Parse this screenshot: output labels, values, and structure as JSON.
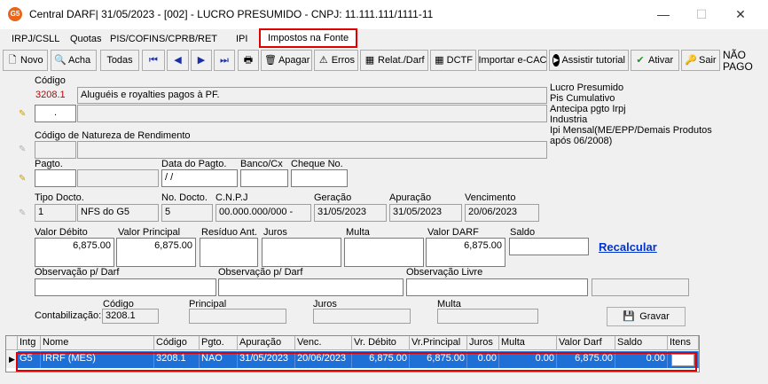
{
  "window": {
    "app_icon": "G5",
    "title": "Central DARF|  31/05/2023 - [002] - LUCRO PRESUMIDO - CNPJ: 11.111.111/1111-11",
    "minimize": "—",
    "maximize": "☐",
    "close": "✕"
  },
  "tabs": [
    "IRPJ/CSLL",
    "Quotas",
    "PIS/COFINS/CPRB/RET",
    "IPI",
    "Impostos na Fonte"
  ],
  "toolbar": {
    "novo": "Novo",
    "acha": "Acha",
    "todas": "Todas",
    "apagar": "Apagar",
    "erros": "Erros",
    "relat": "Relat./Darf",
    "dctf": "DCTF",
    "importar": "Importar e-CAC",
    "assistir": "Assistir tutorial",
    "ativar": "Ativar",
    "sair": "Sair",
    "status_line1": "NÃO",
    "status_line2": "PAGO"
  },
  "form": {
    "codigo_label": "Código",
    "codigo_value": "3208.1",
    "descricao": "Aluguéis e royalties pagos à PF.",
    "small_value": ".",
    "natureza_label": "Código de Natureza de Rendimento",
    "pagto_label": "Pagto.",
    "data_pagto_label": "Data do Pagto.",
    "data_pagto_value": " / /",
    "banco_label": "Banco/Cx",
    "cheque_label": "Cheque No.",
    "tipo_docto_label": "Tipo Docto.",
    "tipo_docto_num": "1",
    "tipo_docto_desc": "NFS do G5",
    "no_docto_label": "No. Docto.",
    "no_docto_value": "5",
    "cnpj_label": "C.N.P.J",
    "cnpj_value": "00.000.000/000 -",
    "geracao_label": "Geração",
    "geracao_value": "31/05/2023",
    "apuracao_label": "Apuração",
    "apuracao_value": "31/05/2023",
    "vencimento_label": "Vencimento",
    "vencimento_value": "20/06/2023",
    "valor_debito_label": "Valor Débito",
    "valor_debito_value": "6,875.00",
    "valor_principal_label": "Valor Principal",
    "valor_principal_value": "6,875.00",
    "residuo_label": "Resíduo Ant.",
    "juros_label": "Juros",
    "multa_label": "Multa",
    "valor_darf_label": "Valor DARF",
    "valor_darf_value": "6,875.00",
    "saldo_label": "Saldo",
    "recalcular": "Recalcular",
    "obs_darf1_label": "Observação p/ Darf",
    "obs_darf2_label": "Observação p/ Darf",
    "obs_livre_label": "Observação Livre",
    "cont_codigo_label": "Código",
    "cont_principal_label": "Principal",
    "cont_juros_label": "Juros",
    "cont_multa_label": "Multa",
    "contabilizacao_label": "Contabilização:",
    "cont_codigo_value": "3208.1",
    "gravar": "Gravar"
  },
  "company_info": [
    "Lucro Presumido",
    "Pis Cumulativo",
    "Antecipa pgto Irpj",
    "Industria",
    "Ipi Mensal(ME/EPP/Demais Produtos",
    "após 06/2008)"
  ],
  "grid": {
    "headers": [
      "Intg",
      "Nome",
      "Código",
      "Pgto.",
      "Apuração",
      "Venc.",
      "Vr. Débito",
      "Vr.Principal",
      "Juros",
      "Multa",
      "Valor Darf",
      "Saldo",
      "Itens"
    ],
    "row": [
      "G5",
      "IRRF (MES)",
      "3208.1",
      "NÃO",
      "31/05/2023",
      "20/06/2023",
      "6,875.00",
      "6,875.00",
      "0.00",
      "0.00",
      "6,875.00",
      "0.00",
      ""
    ],
    "row_marker": "▶"
  }
}
